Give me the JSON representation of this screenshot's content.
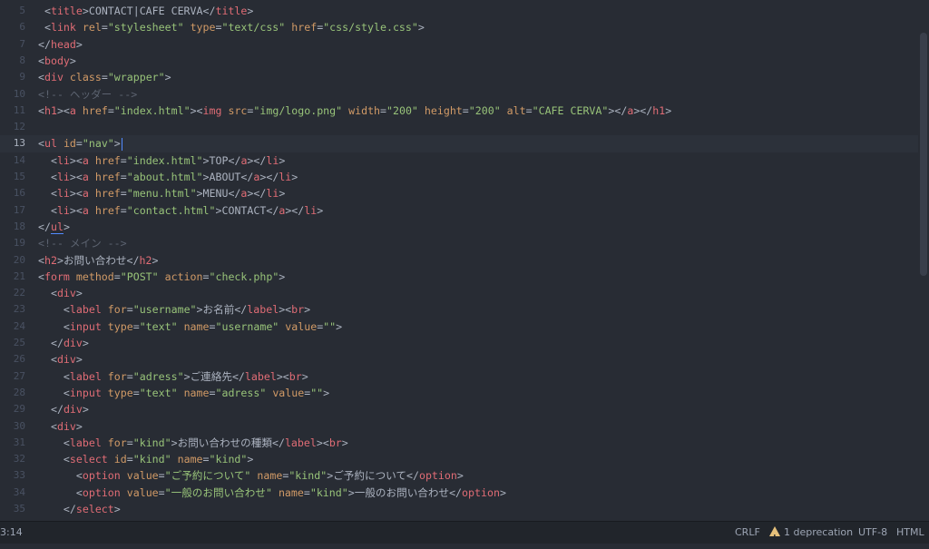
{
  "lines": [
    {
      "num": "5",
      "segs": [
        [
          "p",
          " <"
        ],
        [
          "t",
          "title"
        ],
        [
          "p",
          ">"
        ],
        [
          "x",
          "CONTACT|CAFE CERVA"
        ],
        [
          "p",
          "</"
        ],
        [
          "t",
          "title"
        ],
        [
          "p",
          ">"
        ]
      ]
    },
    {
      "num": "6",
      "segs": [
        [
          "p",
          " <"
        ],
        [
          "t",
          "link"
        ],
        [
          "x",
          " "
        ],
        [
          "a",
          "rel"
        ],
        [
          "p",
          "="
        ],
        [
          "s",
          "\"stylesheet\""
        ],
        [
          "x",
          " "
        ],
        [
          "a",
          "type"
        ],
        [
          "p",
          "="
        ],
        [
          "s",
          "\"text/css\""
        ],
        [
          "x",
          " "
        ],
        [
          "a",
          "href"
        ],
        [
          "p",
          "="
        ],
        [
          "s",
          "\"css/style.css\""
        ],
        [
          "p",
          ">"
        ]
      ]
    },
    {
      "num": "7",
      "segs": [
        [
          "p",
          "</"
        ],
        [
          "t",
          "head"
        ],
        [
          "p",
          ">"
        ]
      ]
    },
    {
      "num": "8",
      "segs": [
        [
          "p",
          "<"
        ],
        [
          "t",
          "body"
        ],
        [
          "p",
          ">"
        ]
      ]
    },
    {
      "num": "9",
      "segs": [
        [
          "p",
          "<"
        ],
        [
          "t",
          "div"
        ],
        [
          "x",
          " "
        ],
        [
          "a",
          "class"
        ],
        [
          "p",
          "="
        ],
        [
          "s",
          "\"wrapper\""
        ],
        [
          "p",
          ">"
        ]
      ]
    },
    {
      "num": "10",
      "segs": [
        [
          "c",
          "<!-- ヘッダー -->"
        ]
      ]
    },
    {
      "num": "11",
      "segs": [
        [
          "p",
          "<"
        ],
        [
          "t",
          "h1"
        ],
        [
          "p",
          "><"
        ],
        [
          "t",
          "a"
        ],
        [
          "x",
          " "
        ],
        [
          "a",
          "href"
        ],
        [
          "p",
          "="
        ],
        [
          "s",
          "\"index.html\""
        ],
        [
          "p",
          "><"
        ],
        [
          "t",
          "img"
        ],
        [
          "x",
          " "
        ],
        [
          "a",
          "src"
        ],
        [
          "p",
          "="
        ],
        [
          "s",
          "\"img/logo.png\""
        ],
        [
          "x",
          " "
        ],
        [
          "a",
          "width"
        ],
        [
          "p",
          "="
        ],
        [
          "s",
          "\"200\""
        ],
        [
          "x",
          " "
        ],
        [
          "a",
          "height"
        ],
        [
          "p",
          "="
        ],
        [
          "s",
          "\"200\""
        ],
        [
          "x",
          " "
        ],
        [
          "a",
          "alt"
        ],
        [
          "p",
          "="
        ],
        [
          "s",
          "\"CAFE CERVA\""
        ],
        [
          "p",
          "></"
        ],
        [
          "t",
          "a"
        ],
        [
          "p",
          "></"
        ],
        [
          "t",
          "h1"
        ],
        [
          "p",
          ">"
        ]
      ]
    },
    {
      "num": "12",
      "segs": []
    },
    {
      "num": "13",
      "current": true,
      "segs": [
        [
          "p",
          "<"
        ],
        [
          "t",
          "ul"
        ],
        [
          "x",
          " "
        ],
        [
          "a",
          "id"
        ],
        [
          "p",
          "="
        ],
        [
          "s",
          "\"nav\""
        ],
        [
          "p",
          ">"
        ],
        [
          "cursor",
          ""
        ]
      ]
    },
    {
      "num": "14",
      "segs": [
        [
          "x",
          "  "
        ],
        [
          "p",
          "<"
        ],
        [
          "t",
          "li"
        ],
        [
          "p",
          "><"
        ],
        [
          "t",
          "a"
        ],
        [
          "x",
          " "
        ],
        [
          "a",
          "href"
        ],
        [
          "p",
          "="
        ],
        [
          "s",
          "\"index.html\""
        ],
        [
          "p",
          ">"
        ],
        [
          "x",
          "TOP"
        ],
        [
          "p",
          "</"
        ],
        [
          "t",
          "a"
        ],
        [
          "p",
          "></"
        ],
        [
          "t",
          "li"
        ],
        [
          "p",
          ">"
        ]
      ]
    },
    {
      "num": "15",
      "segs": [
        [
          "x",
          "  "
        ],
        [
          "p",
          "<"
        ],
        [
          "t",
          "li"
        ],
        [
          "p",
          "><"
        ],
        [
          "t",
          "a"
        ],
        [
          "x",
          " "
        ],
        [
          "a",
          "href"
        ],
        [
          "p",
          "="
        ],
        [
          "s",
          "\"about.html\""
        ],
        [
          "p",
          ">"
        ],
        [
          "x",
          "ABOUT"
        ],
        [
          "p",
          "</"
        ],
        [
          "t",
          "a"
        ],
        [
          "p",
          "></"
        ],
        [
          "t",
          "li"
        ],
        [
          "p",
          ">"
        ]
      ]
    },
    {
      "num": "16",
      "segs": [
        [
          "x",
          "  "
        ],
        [
          "p",
          "<"
        ],
        [
          "t",
          "li"
        ],
        [
          "p",
          "><"
        ],
        [
          "t",
          "a"
        ],
        [
          "x",
          " "
        ],
        [
          "a",
          "href"
        ],
        [
          "p",
          "="
        ],
        [
          "s",
          "\"menu.html\""
        ],
        [
          "p",
          ">"
        ],
        [
          "x",
          "MENU"
        ],
        [
          "p",
          "</"
        ],
        [
          "t",
          "a"
        ],
        [
          "p",
          "></"
        ],
        [
          "t",
          "li"
        ],
        [
          "p",
          ">"
        ]
      ]
    },
    {
      "num": "17",
      "segs": [
        [
          "x",
          "  "
        ],
        [
          "p",
          "<"
        ],
        [
          "t",
          "li"
        ],
        [
          "p",
          "><"
        ],
        [
          "t",
          "a"
        ],
        [
          "x",
          " "
        ],
        [
          "a",
          "href"
        ],
        [
          "p",
          "="
        ],
        [
          "s",
          "\"contact.html\""
        ],
        [
          "p",
          ">"
        ],
        [
          "x",
          "CONTACT"
        ],
        [
          "p",
          "</"
        ],
        [
          "t",
          "a"
        ],
        [
          "p",
          "></"
        ],
        [
          "t",
          "li"
        ],
        [
          "p",
          ">"
        ]
      ]
    },
    {
      "num": "18",
      "segs": [
        [
          "p",
          "</"
        ],
        [
          "tm",
          "ul"
        ],
        [
          "p",
          ">"
        ]
      ]
    },
    {
      "num": "19",
      "segs": [
        [
          "c",
          "<!-- メイン -->"
        ]
      ]
    },
    {
      "num": "20",
      "segs": [
        [
          "p",
          "<"
        ],
        [
          "t",
          "h2"
        ],
        [
          "p",
          ">"
        ],
        [
          "x",
          "お問い合わせ"
        ],
        [
          "p",
          "</"
        ],
        [
          "t",
          "h2"
        ],
        [
          "p",
          ">"
        ]
      ]
    },
    {
      "num": "21",
      "segs": [
        [
          "p",
          "<"
        ],
        [
          "t",
          "form"
        ],
        [
          "x",
          " "
        ],
        [
          "a",
          "method"
        ],
        [
          "p",
          "="
        ],
        [
          "s",
          "\"POST\""
        ],
        [
          "x",
          " "
        ],
        [
          "a",
          "action"
        ],
        [
          "p",
          "="
        ],
        [
          "s",
          "\"check.php\""
        ],
        [
          "p",
          ">"
        ]
      ]
    },
    {
      "num": "22",
      "segs": [
        [
          "x",
          "  "
        ],
        [
          "p",
          "<"
        ],
        [
          "t",
          "div"
        ],
        [
          "p",
          ">"
        ]
      ]
    },
    {
      "num": "23",
      "segs": [
        [
          "x",
          "    "
        ],
        [
          "p",
          "<"
        ],
        [
          "t",
          "label"
        ],
        [
          "x",
          " "
        ],
        [
          "a",
          "for"
        ],
        [
          "p",
          "="
        ],
        [
          "s",
          "\"username\""
        ],
        [
          "p",
          ">"
        ],
        [
          "x",
          "お名前"
        ],
        [
          "p",
          "</"
        ],
        [
          "t",
          "label"
        ],
        [
          "p",
          "><"
        ],
        [
          "t",
          "br"
        ],
        [
          "p",
          ">"
        ]
      ]
    },
    {
      "num": "24",
      "segs": [
        [
          "x",
          "    "
        ],
        [
          "p",
          "<"
        ],
        [
          "t",
          "input"
        ],
        [
          "x",
          " "
        ],
        [
          "a",
          "type"
        ],
        [
          "p",
          "="
        ],
        [
          "s",
          "\"text\""
        ],
        [
          "x",
          " "
        ],
        [
          "a",
          "name"
        ],
        [
          "p",
          "="
        ],
        [
          "s",
          "\"username\""
        ],
        [
          "x",
          " "
        ],
        [
          "a",
          "value"
        ],
        [
          "p",
          "="
        ],
        [
          "s",
          "\"\""
        ],
        [
          "p",
          ">"
        ]
      ]
    },
    {
      "num": "25",
      "segs": [
        [
          "x",
          "  "
        ],
        [
          "p",
          "</"
        ],
        [
          "t",
          "div"
        ],
        [
          "p",
          ">"
        ]
      ]
    },
    {
      "num": "26",
      "segs": [
        [
          "x",
          "  "
        ],
        [
          "p",
          "<"
        ],
        [
          "t",
          "div"
        ],
        [
          "p",
          ">"
        ]
      ]
    },
    {
      "num": "27",
      "segs": [
        [
          "x",
          "    "
        ],
        [
          "p",
          "<"
        ],
        [
          "t",
          "label"
        ],
        [
          "x",
          " "
        ],
        [
          "a",
          "for"
        ],
        [
          "p",
          "="
        ],
        [
          "s",
          "\"adress\""
        ],
        [
          "p",
          ">"
        ],
        [
          "x",
          "ご連絡先"
        ],
        [
          "p",
          "</"
        ],
        [
          "t",
          "label"
        ],
        [
          "p",
          "><"
        ],
        [
          "t",
          "br"
        ],
        [
          "p",
          ">"
        ]
      ]
    },
    {
      "num": "28",
      "segs": [
        [
          "x",
          "    "
        ],
        [
          "p",
          "<"
        ],
        [
          "t",
          "input"
        ],
        [
          "x",
          " "
        ],
        [
          "a",
          "type"
        ],
        [
          "p",
          "="
        ],
        [
          "s",
          "\"text\""
        ],
        [
          "x",
          " "
        ],
        [
          "a",
          "name"
        ],
        [
          "p",
          "="
        ],
        [
          "s",
          "\"adress\""
        ],
        [
          "x",
          " "
        ],
        [
          "a",
          "value"
        ],
        [
          "p",
          "="
        ],
        [
          "s",
          "\"\""
        ],
        [
          "p",
          ">"
        ]
      ]
    },
    {
      "num": "29",
      "segs": [
        [
          "x",
          "  "
        ],
        [
          "p",
          "</"
        ],
        [
          "t",
          "div"
        ],
        [
          "p",
          ">"
        ]
      ]
    },
    {
      "num": "30",
      "segs": [
        [
          "x",
          "  "
        ],
        [
          "p",
          "<"
        ],
        [
          "t",
          "div"
        ],
        [
          "p",
          ">"
        ]
      ]
    },
    {
      "num": "31",
      "segs": [
        [
          "x",
          "    "
        ],
        [
          "p",
          "<"
        ],
        [
          "t",
          "label"
        ],
        [
          "x",
          " "
        ],
        [
          "a",
          "for"
        ],
        [
          "p",
          "="
        ],
        [
          "s",
          "\"kind\""
        ],
        [
          "p",
          ">"
        ],
        [
          "x",
          "お問い合わせの種類"
        ],
        [
          "p",
          "</"
        ],
        [
          "t",
          "label"
        ],
        [
          "p",
          "><"
        ],
        [
          "t",
          "br"
        ],
        [
          "p",
          ">"
        ]
      ]
    },
    {
      "num": "32",
      "segs": [
        [
          "x",
          "    "
        ],
        [
          "p",
          "<"
        ],
        [
          "t",
          "select"
        ],
        [
          "x",
          " "
        ],
        [
          "a",
          "id"
        ],
        [
          "p",
          "="
        ],
        [
          "s",
          "\"kind\""
        ],
        [
          "x",
          " "
        ],
        [
          "a",
          "name"
        ],
        [
          "p",
          "="
        ],
        [
          "s",
          "\"kind\""
        ],
        [
          "p",
          ">"
        ]
      ]
    },
    {
      "num": "33",
      "segs": [
        [
          "x",
          "      "
        ],
        [
          "p",
          "<"
        ],
        [
          "t",
          "option"
        ],
        [
          "x",
          " "
        ],
        [
          "a",
          "value"
        ],
        [
          "p",
          "="
        ],
        [
          "s",
          "\"ご予約について\""
        ],
        [
          "x",
          " "
        ],
        [
          "a",
          "name"
        ],
        [
          "p",
          "="
        ],
        [
          "s",
          "\"kind\""
        ],
        [
          "p",
          ">"
        ],
        [
          "x",
          "ご予約について"
        ],
        [
          "p",
          "</"
        ],
        [
          "t",
          "option"
        ],
        [
          "p",
          ">"
        ]
      ]
    },
    {
      "num": "34",
      "segs": [
        [
          "x",
          "      "
        ],
        [
          "p",
          "<"
        ],
        [
          "t",
          "option"
        ],
        [
          "x",
          " "
        ],
        [
          "a",
          "value"
        ],
        [
          "p",
          "="
        ],
        [
          "s",
          "\"一般のお問い合わせ\""
        ],
        [
          "x",
          " "
        ],
        [
          "a",
          "name"
        ],
        [
          "p",
          "="
        ],
        [
          "s",
          "\"kind\""
        ],
        [
          "p",
          ">"
        ],
        [
          "x",
          "一般のお問い合わせ"
        ],
        [
          "p",
          "</"
        ],
        [
          "t",
          "option"
        ],
        [
          "p",
          ">"
        ]
      ]
    },
    {
      "num": "35",
      "segs": [
        [
          "x",
          "    "
        ],
        [
          "p",
          "</"
        ],
        [
          "t",
          "select"
        ],
        [
          "p",
          ">"
        ]
      ]
    }
  ],
  "status": {
    "cursor_pos": "3:14",
    "line_ending": "CRLF",
    "deprecation": "1 deprecation",
    "encoding": "UTF-8",
    "grammar": "HTML"
  },
  "colors": {
    "background": "#282c34",
    "tag": "#e06c75",
    "attr": "#d19a66",
    "string": "#98c379",
    "comment": "#5c6370",
    "warning": "#e5c07b"
  },
  "icons": {
    "deprecation": "warning-triangle-icon"
  }
}
